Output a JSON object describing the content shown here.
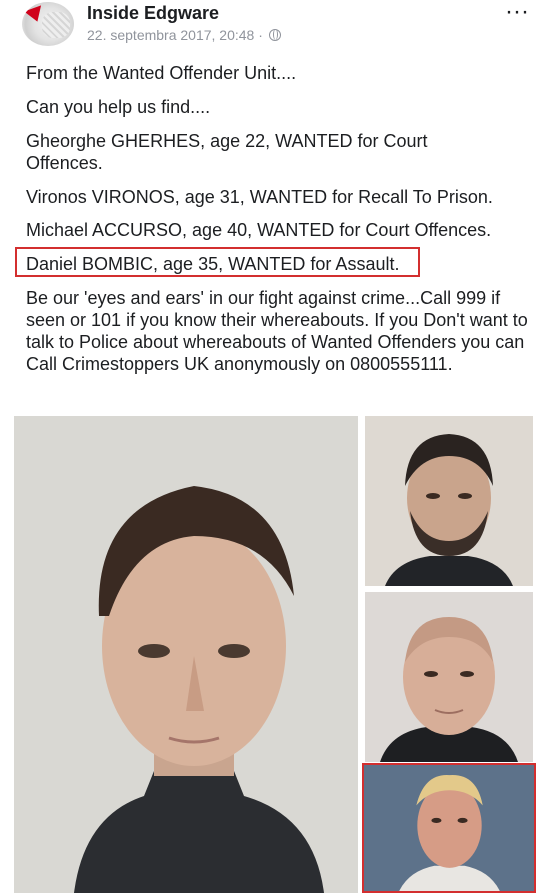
{
  "post": {
    "page_name": "Inside Edgware",
    "timestamp": "22. septembra 2017, 20:48 ·",
    "audience_icon": "globe-icon",
    "more_label": "···"
  },
  "text": {
    "line1": "From the Wanted Offender Unit....",
    "line2": "Can you help us find....",
    "line3": "Gheorghe GHERHES, age 22, WANTED for Court Offences.",
    "line4": "Vironos VIRONOS, age 31, WANTED for Recall To Prison.",
    "line5": "Michael ACCURSO, age 40, WANTED for Court Offences.",
    "line6": "Daniel BOMBIC, age 35, WANTED for Assault.",
    "line7": "Be our 'eyes and ears' in our fight against crime...Call 999 if seen or 101 if you know their whereabouts. If you Don't want to talk to Police about whereabouts of Wanted Offenders you can Call Crimestoppers UK anonymously on 0800555111."
  },
  "colors": {
    "highlight": "#d32f2f",
    "meta_text": "#90949c",
    "body_text": "#1c1e21"
  }
}
